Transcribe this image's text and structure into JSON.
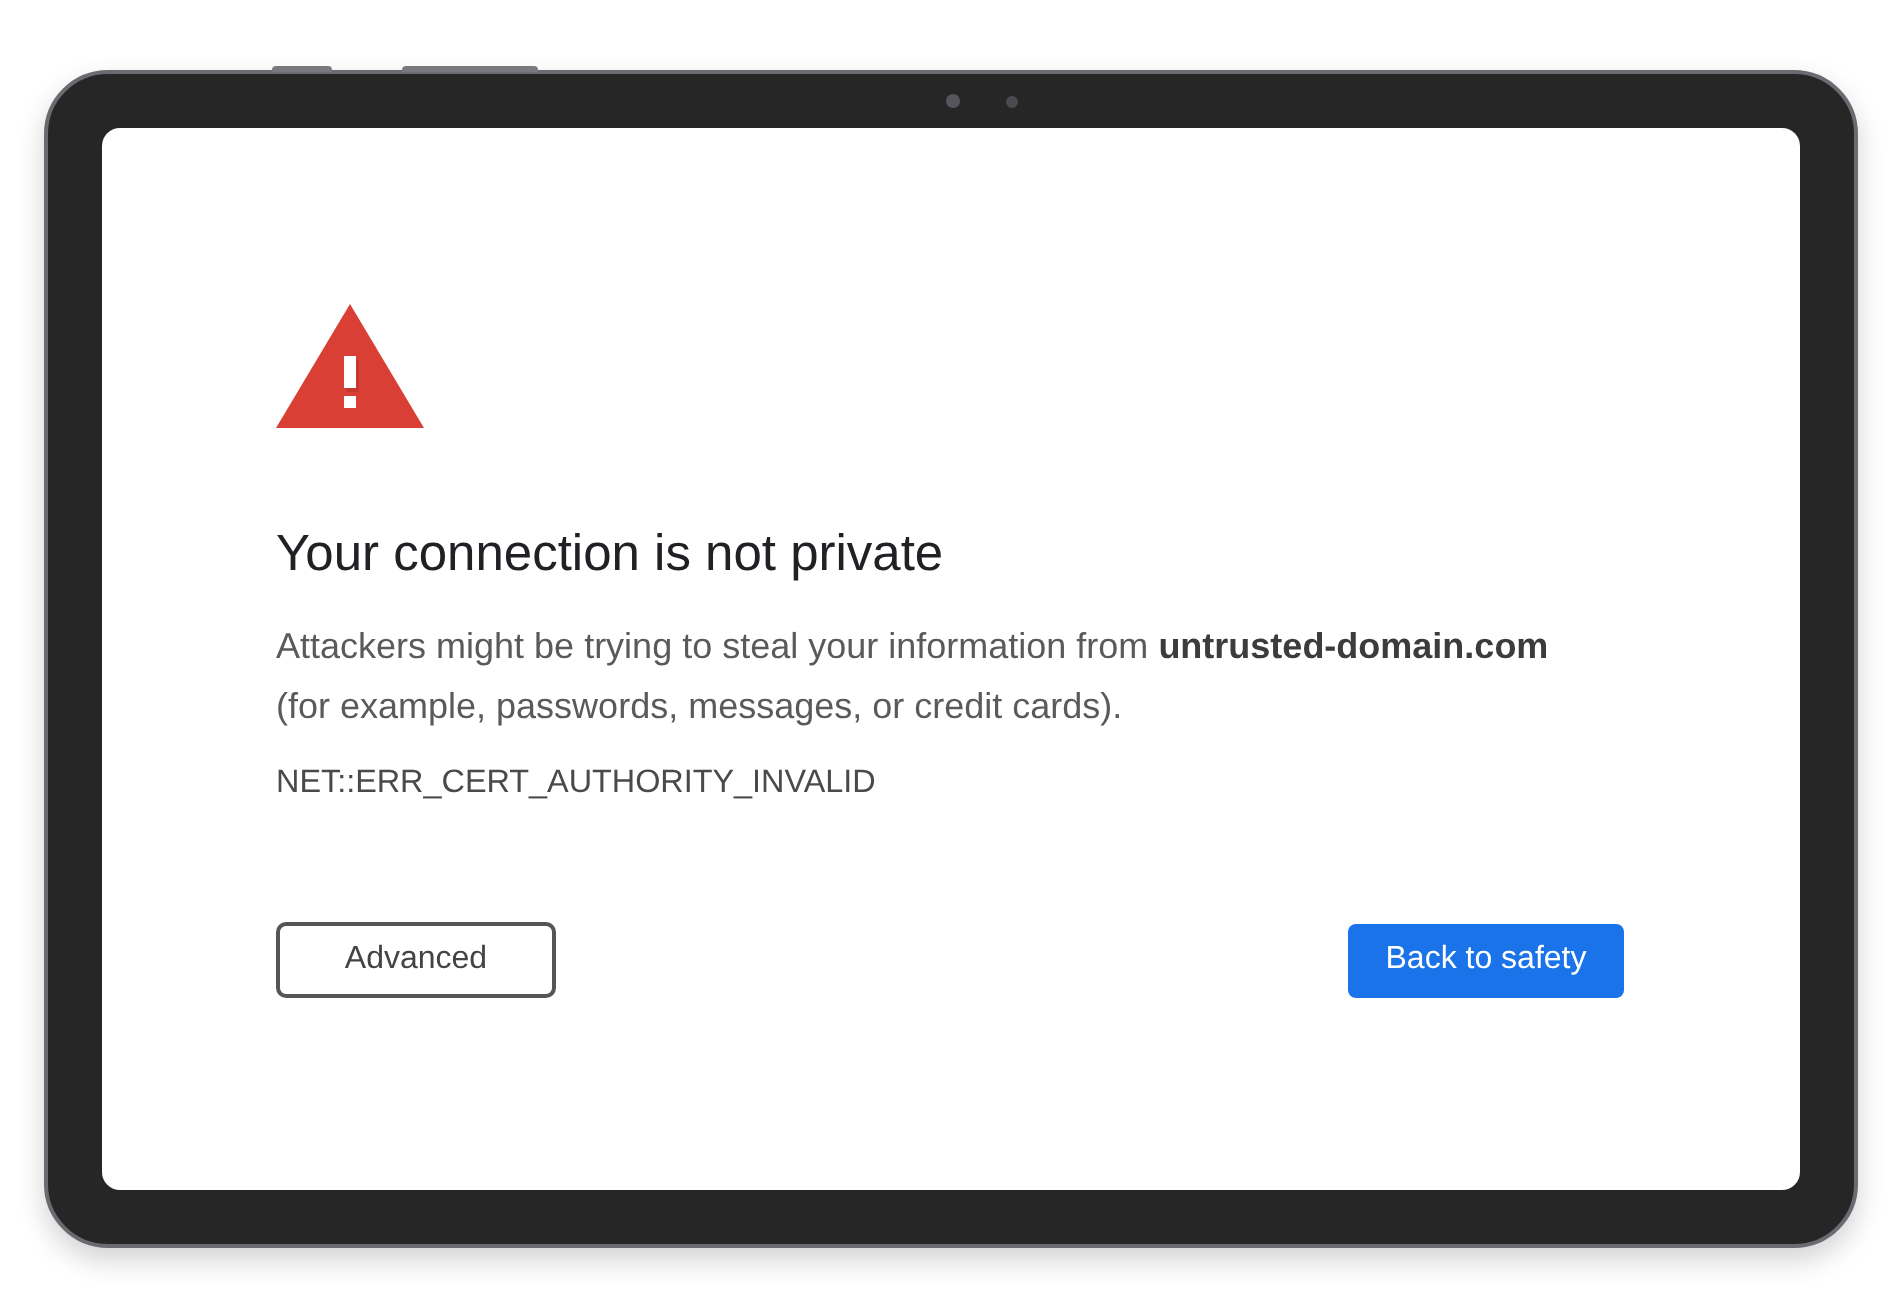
{
  "page": {
    "heading": "Your connection is not private",
    "message": "Attackers might be trying to steal your information from **untrusted-domain.com** (for example, passwords, messages, or credit cards).",
    "error_code": "NET::ERR_CERT_AUTHORITY_INVALID"
  },
  "buttons": [
    {
      "label": "Advanced",
      "kind": "outline"
    },
    {
      "label": "Back to safety",
      "kind": "primary"
    }
  ]
}
